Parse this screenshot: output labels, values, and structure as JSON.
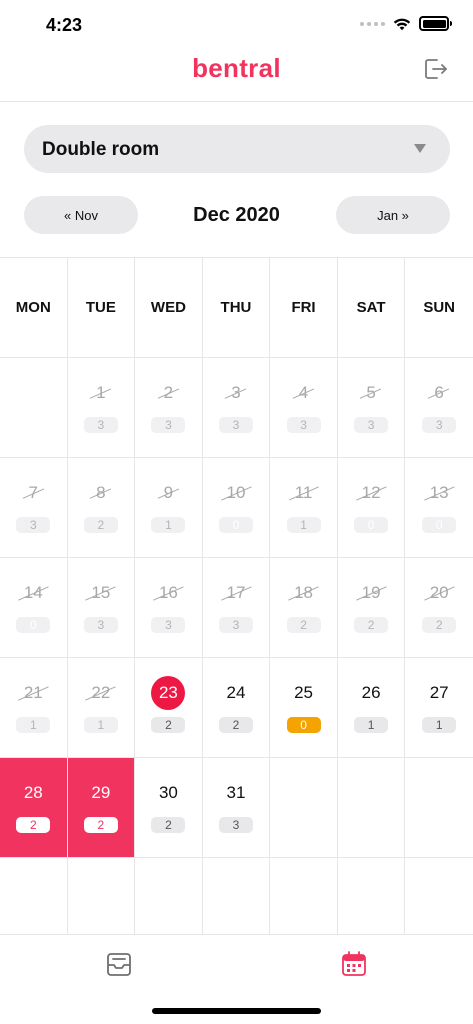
{
  "status": {
    "time": "4:23"
  },
  "header": {
    "brand": "bentral",
    "logout_icon": "logout-icon",
    "brand_color": "#f0335f"
  },
  "room": {
    "selected": "Double room"
  },
  "month_nav": {
    "prev_label": "« Nov",
    "title": "Dec 2020",
    "next_label": "Jan »"
  },
  "calendar": {
    "weekdays": [
      "MON",
      "TUE",
      "WED",
      "THU",
      "FRI",
      "SAT",
      "SUN"
    ],
    "weeks": [
      [
        {
          "day": "",
          "count": "",
          "state": "empty"
        },
        {
          "day": "1",
          "count": "3",
          "state": "past"
        },
        {
          "day": "2",
          "count": "3",
          "state": "past"
        },
        {
          "day": "3",
          "count": "3",
          "state": "past"
        },
        {
          "day": "4",
          "count": "3",
          "state": "past"
        },
        {
          "day": "5",
          "count": "3",
          "state": "past"
        },
        {
          "day": "6",
          "count": "3",
          "state": "past"
        }
      ],
      [
        {
          "day": "7",
          "count": "3",
          "state": "past"
        },
        {
          "day": "8",
          "count": "2",
          "state": "past"
        },
        {
          "day": "9",
          "count": "1",
          "state": "past"
        },
        {
          "day": "10",
          "count": "0",
          "state": "past"
        },
        {
          "day": "11",
          "count": "1",
          "state": "past"
        },
        {
          "day": "12",
          "count": "0",
          "state": "past"
        },
        {
          "day": "13",
          "count": "0",
          "state": "past"
        }
      ],
      [
        {
          "day": "14",
          "count": "0",
          "state": "past"
        },
        {
          "day": "15",
          "count": "3",
          "state": "past"
        },
        {
          "day": "16",
          "count": "3",
          "state": "past"
        },
        {
          "day": "17",
          "count": "3",
          "state": "past"
        },
        {
          "day": "18",
          "count": "2",
          "state": "past"
        },
        {
          "day": "19",
          "count": "2",
          "state": "past"
        },
        {
          "day": "20",
          "count": "2",
          "state": "past"
        }
      ],
      [
        {
          "day": "21",
          "count": "1",
          "state": "past"
        },
        {
          "day": "22",
          "count": "1",
          "state": "past"
        },
        {
          "day": "23",
          "count": "2",
          "state": "today"
        },
        {
          "day": "24",
          "count": "2",
          "state": "normal"
        },
        {
          "day": "25",
          "count": "0",
          "state": "zero-avail"
        },
        {
          "day": "26",
          "count": "1",
          "state": "normal"
        },
        {
          "day": "27",
          "count": "1",
          "state": "normal"
        }
      ],
      [
        {
          "day": "28",
          "count": "2",
          "state": "selected"
        },
        {
          "day": "29",
          "count": "2",
          "state": "selected"
        },
        {
          "day": "30",
          "count": "2",
          "state": "normal"
        },
        {
          "day": "31",
          "count": "3",
          "state": "normal"
        },
        {
          "day": "",
          "count": "",
          "state": "empty"
        },
        {
          "day": "",
          "count": "",
          "state": "empty"
        },
        {
          "day": "",
          "count": "",
          "state": "empty"
        }
      ],
      [
        {
          "day": "",
          "count": "",
          "state": "empty"
        },
        {
          "day": "",
          "count": "",
          "state": "empty"
        },
        {
          "day": "",
          "count": "",
          "state": "empty"
        },
        {
          "day": "",
          "count": "",
          "state": "empty"
        },
        {
          "day": "",
          "count": "",
          "state": "empty"
        },
        {
          "day": "",
          "count": "",
          "state": "empty"
        },
        {
          "day": "",
          "count": "",
          "state": "empty"
        }
      ]
    ],
    "colors": {
      "selected": "#f0335f",
      "today": "#ee1844",
      "zero_availability": "#f4a300"
    }
  },
  "tab_bar": {
    "items": [
      {
        "icon": "inbox-icon",
        "active": false
      },
      {
        "icon": "calendar-icon",
        "active": true
      }
    ]
  }
}
